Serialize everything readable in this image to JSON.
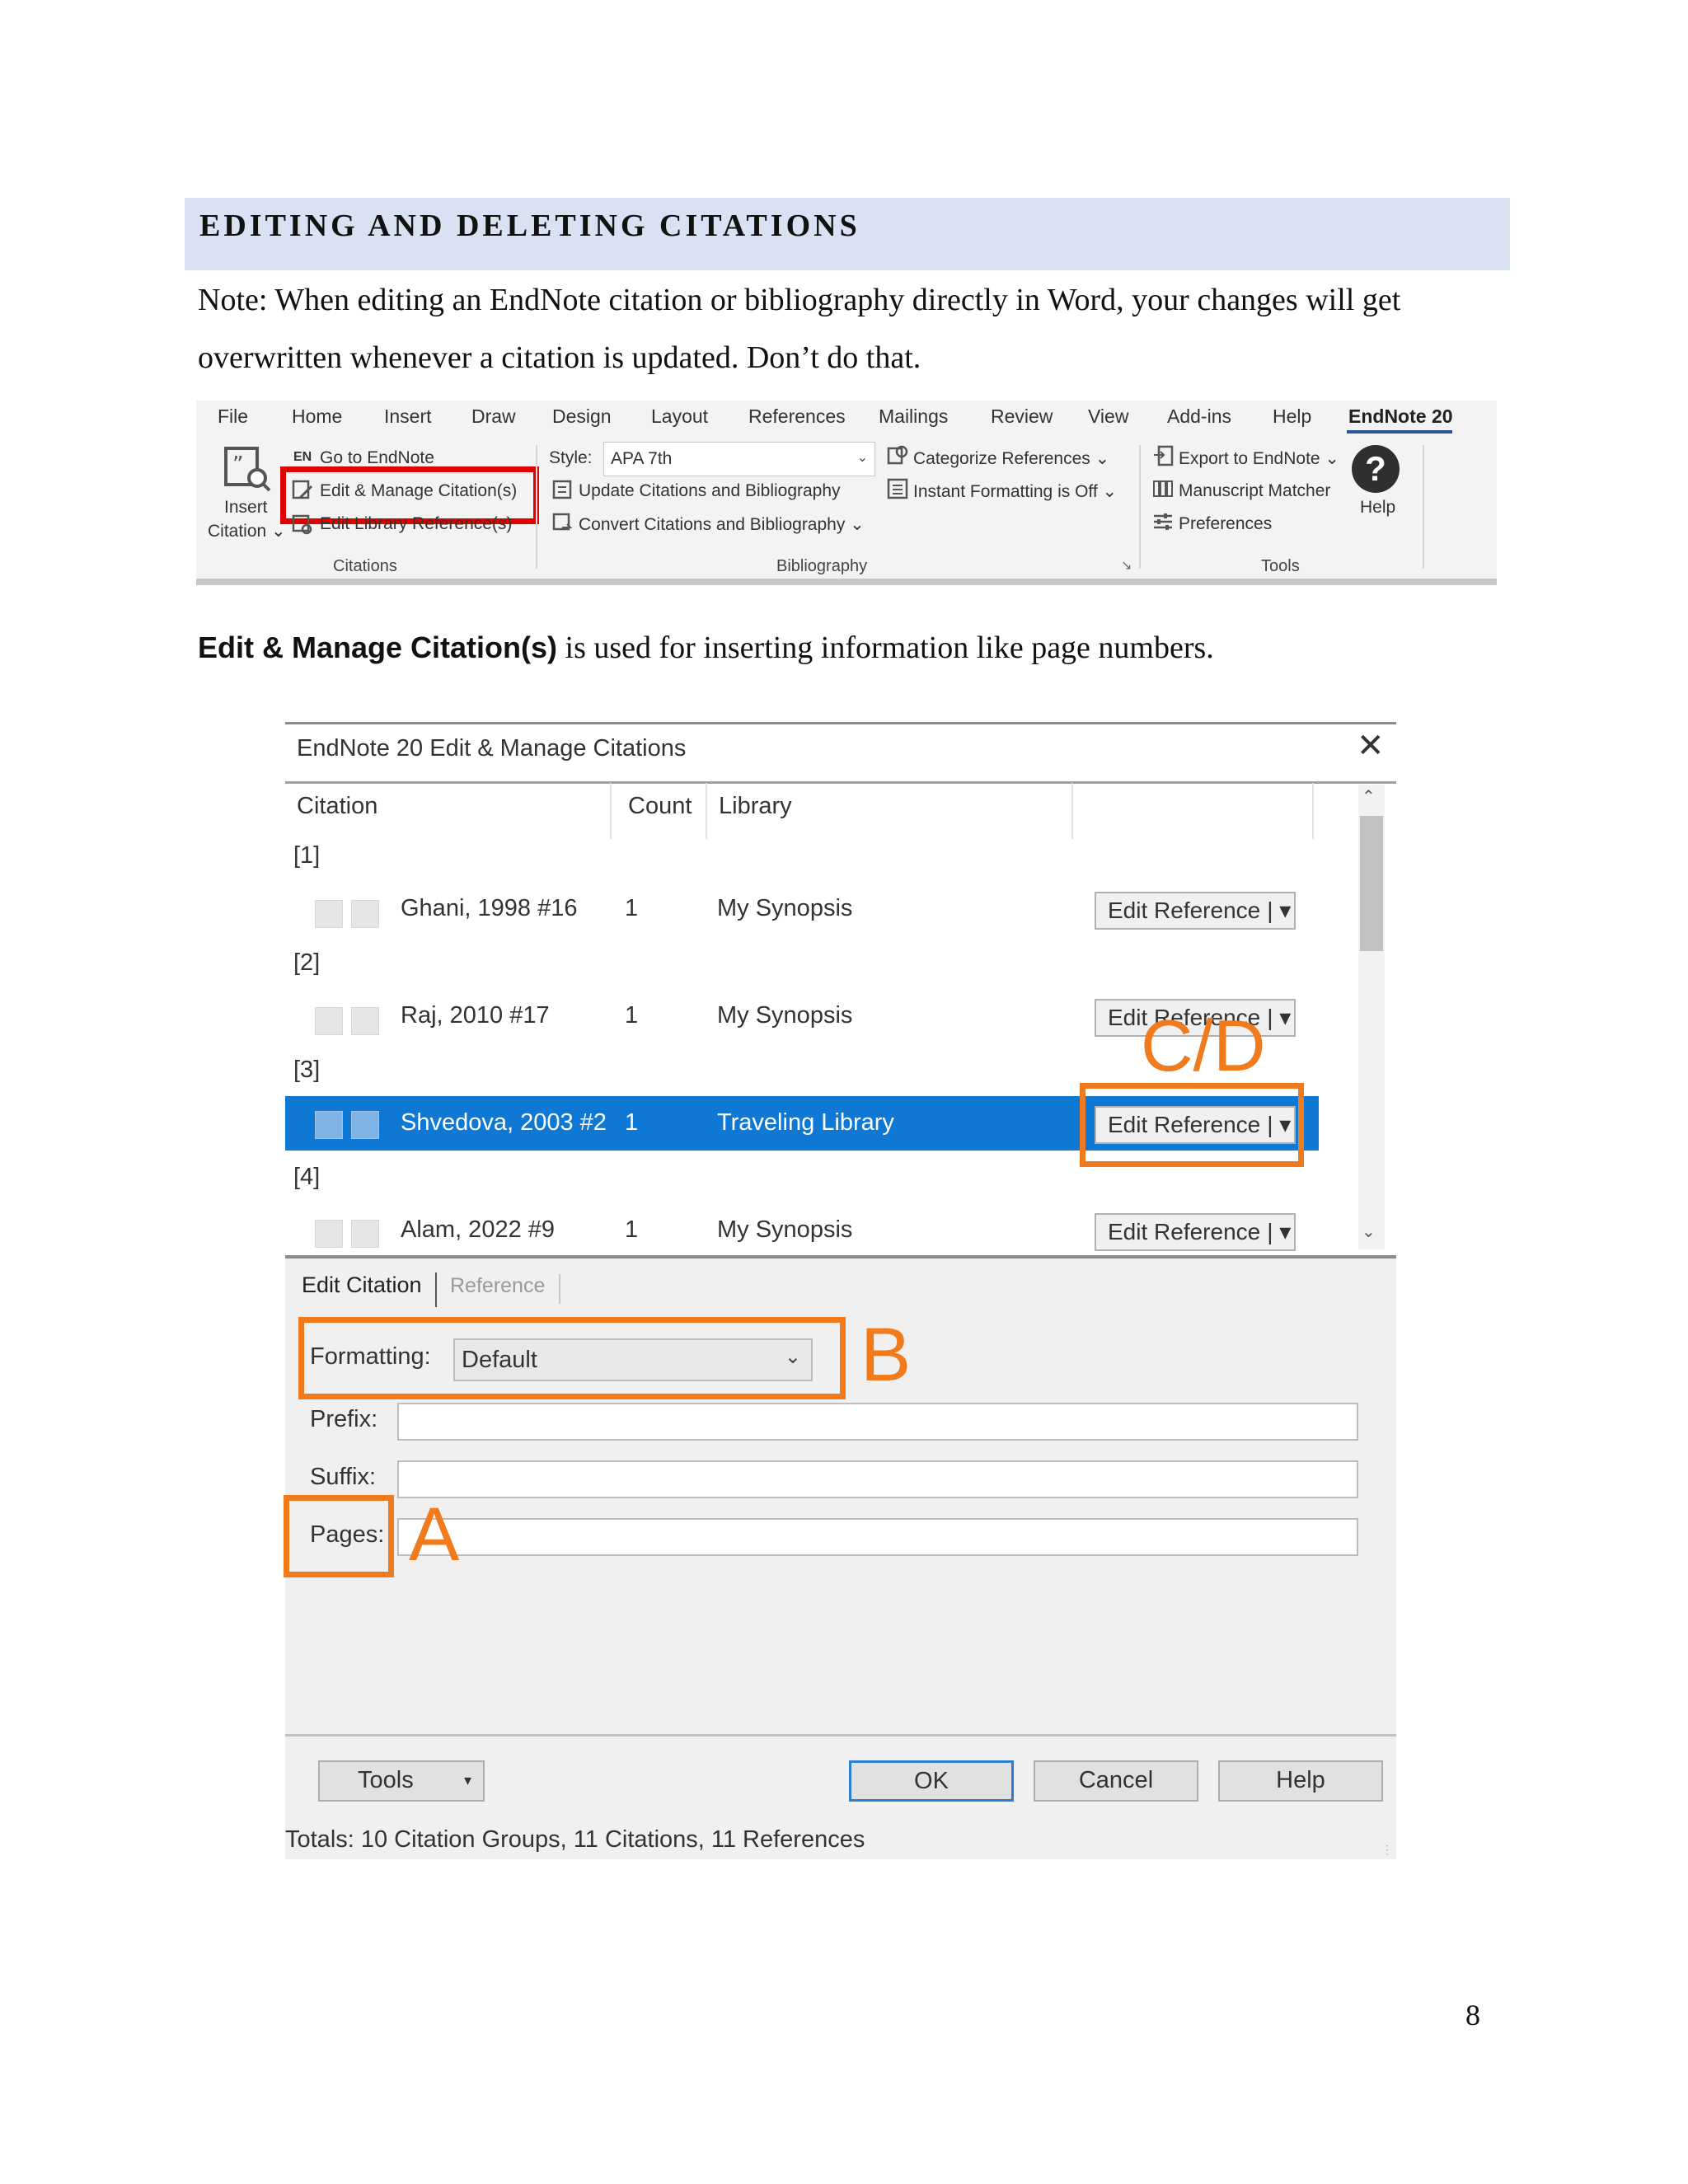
{
  "section": {
    "title": "EDITING AND DELETING CITATIONS",
    "note_line1": "Note: When editing an EndNote citation or bibliography directly in Word, your changes will get",
    "note_line2": "overwritten whenever a citation is updated. Don’t do that."
  },
  "ribbon": {
    "tabs": [
      "File",
      "Home",
      "Insert",
      "Draw",
      "Design",
      "Layout",
      "References",
      "Mailings",
      "Review",
      "View",
      "Add-ins",
      "Help",
      "EndNote 20"
    ],
    "citations": {
      "insert_label_1": "Insert",
      "insert_label_2": "Citation ⌄",
      "goto_prefix": "EN",
      "goto": "Go to EndNote",
      "edit_manage": "Edit & Manage Citation(s)",
      "edit_library": "Edit Library Reference(s)",
      "group_label": "Citations"
    },
    "bibliography": {
      "style_label": "Style:",
      "style_value": "APA 7th",
      "update": "Update Citations and Bibliography",
      "convert": "Convert Citations and Bibliography ⌄",
      "categorize": "Categorize References ⌄",
      "instant": "Instant Formatting is Off ⌄",
      "group_label": "Bibliography"
    },
    "tools": {
      "export": "Export to EndNote ⌄",
      "matcher": "Manuscript Matcher",
      "preferences": "Preferences",
      "help": "Help",
      "group_label": "Tools"
    }
  },
  "caption": {
    "bold": "Edit & Manage Citation(s)",
    "rest": " is used for inserting information like page numbers."
  },
  "dialog": {
    "title": "EndNote 20 Edit & Manage Citations",
    "columns": [
      "Citation",
      "Count",
      "Library"
    ],
    "groups": [
      {
        "label": "[1]",
        "citation": "Ghani, 1998 #16",
        "count": "1",
        "library": "My Synopsis",
        "button": "Edit Reference"
      },
      {
        "label": "[2]",
        "citation": "Raj, 2010 #17",
        "count": "1",
        "library": "My Synopsis",
        "button": "Edit Reference"
      },
      {
        "label": "[3]",
        "citation": "Shvedova, 2003 #2",
        "count": "1",
        "library": "Traveling Library",
        "button": "Edit Reference"
      },
      {
        "label": "[4]",
        "citation": "Alam, 2022 #9",
        "count": "1",
        "library": "My Synopsis",
        "button": "Edit Reference"
      }
    ],
    "tabs": [
      "Edit Citation",
      "Reference"
    ],
    "formatting_label": "Formatting:",
    "formatting_value": "Default",
    "prefix_label": "Prefix:",
    "suffix_label": "Suffix:",
    "pages_label": "Pages:",
    "buttons": {
      "tools": "Tools",
      "ok": "OK",
      "cancel": "Cancel",
      "help": "Help"
    },
    "totals": "Totals: 10 Citation Groups, 11 Citations, 11 References"
  },
  "annotations": {
    "cd": "C/D",
    "b": "B",
    "a": "A"
  },
  "page_number": "8",
  "colors": {
    "header_band": "#d9e1f2",
    "selection": "#0e78d4",
    "annotation_orange": "#f07a1c",
    "annotation_red": "#e00000"
  }
}
